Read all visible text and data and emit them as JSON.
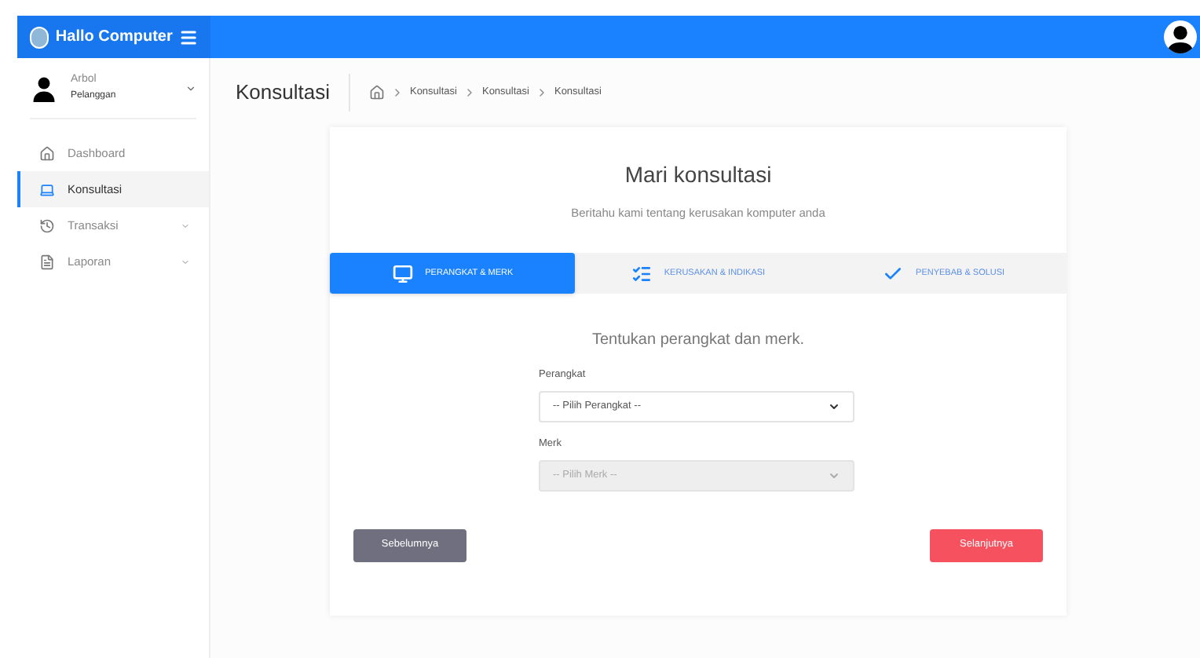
{
  "brand": "Hallo Computer",
  "user": {
    "name": "Arbol",
    "role": "Pelanggan"
  },
  "sidebar": {
    "items": [
      {
        "label": "Dashboard",
        "selected": false,
        "has_submenu": false
      },
      {
        "label": "Konsultasi",
        "selected": true,
        "has_submenu": false
      },
      {
        "label": "Transaksi",
        "selected": false,
        "has_submenu": true
      },
      {
        "label": "Laporan",
        "selected": false,
        "has_submenu": true
      }
    ]
  },
  "page_title": "Konsultasi",
  "breadcrumb": [
    "Konsultasi",
    "Konsultasi",
    "Konsultasi"
  ],
  "card": {
    "title": "Mari konsultasi",
    "subtitle": "Beritahu kami tentang kerusakan komputer anda",
    "steps": [
      {
        "label": "PERANGKAT & MERK",
        "selected": true
      },
      {
        "label": "KERUSAKAN & INDIKASI",
        "selected": false
      },
      {
        "label": "PENYEBAB & SOLUSI",
        "selected": false
      }
    ],
    "heading": "Tentukan perangkat dan merk.",
    "fields": [
      {
        "label": "Perangkat",
        "value": "-- Pilih Perangkat --",
        "disabled": false
      },
      {
        "label": "Merk",
        "value": "-- Pilih Merk --",
        "disabled": true
      }
    ],
    "buttons": {
      "previous": "Sebelumnya",
      "next": "Selanjutnya"
    }
  }
}
